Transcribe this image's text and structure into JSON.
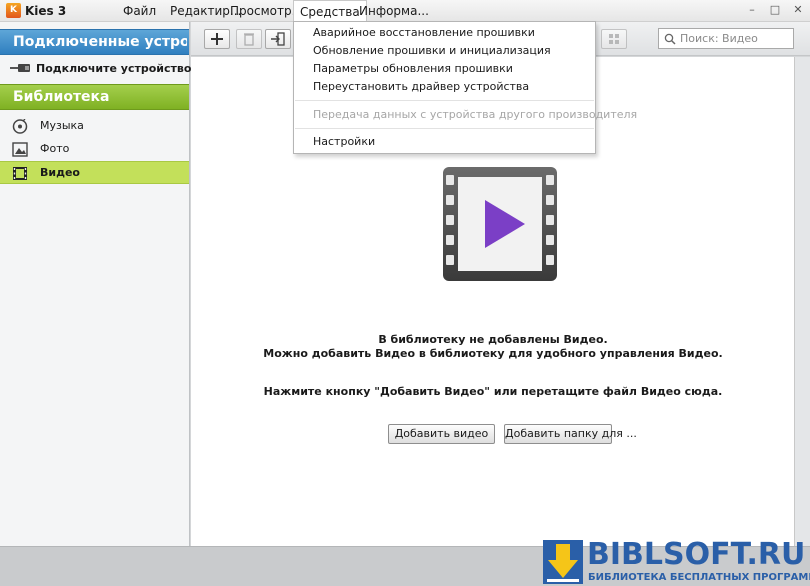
{
  "app": {
    "logo_text": "K",
    "title": "Kies 3"
  },
  "menu": {
    "file": "Файл",
    "edit": "Редактир...",
    "view": "Просмотр...",
    "tools": "Средства",
    "info": "Информа..."
  },
  "window_controls": {
    "minimize": "–",
    "maximize": "□",
    "close": "✕"
  },
  "sidebar": {
    "connected_title": "Подключенные устро...",
    "device_prompt": "Подключите устройство.",
    "library_title": "Библиотека",
    "items": [
      {
        "label": "Музыка",
        "icon": "music-icon"
      },
      {
        "label": "Фото",
        "icon": "photo-icon"
      },
      {
        "label": "Видео",
        "icon": "video-icon",
        "selected": true
      }
    ]
  },
  "toolbar": {
    "search_placeholder": "Поиск: Видео",
    "buttons": [
      "add-icon",
      "delete-icon",
      "export-icon",
      "grid-view-icon"
    ]
  },
  "tools_menu": {
    "items": [
      {
        "label": "Аварийное восстановление прошивки",
        "enabled": true
      },
      {
        "label": "Обновление прошивки и инициализация",
        "enabled": true
      },
      {
        "label": "Параметры обновления прошивки",
        "enabled": true
      },
      {
        "label": "Переустановить драйвер устройства",
        "enabled": true
      },
      {
        "label": "Передача данных с устройства другого производителя",
        "enabled": false
      },
      {
        "label": "Настройки",
        "enabled": true
      }
    ]
  },
  "main": {
    "empty_line1": "В библиотеку не добавлены Видео.",
    "empty_line2": "Можно добавить Видео в библиотеку для удобного управления Видео.",
    "hint": "Нажмите кнопку \"Добавить Видео\" или перетащите файл Видео сюда.",
    "add_video_button": "Добавить видео",
    "add_folder_button": "Добавить папку для ..."
  },
  "watermark": {
    "title": "BIBLSOFT.RU",
    "subtitle": "БИБЛИОТЕКА БЕСПЛАТНЫХ ПРОГРАММ"
  },
  "colors": {
    "connected_header": "#3a88c8",
    "library_header": "#8cbd2d",
    "selected_item": "#c3e05a",
    "play_triangle": "#7b3fc6",
    "watermark_blue": "#2a5fa8"
  }
}
